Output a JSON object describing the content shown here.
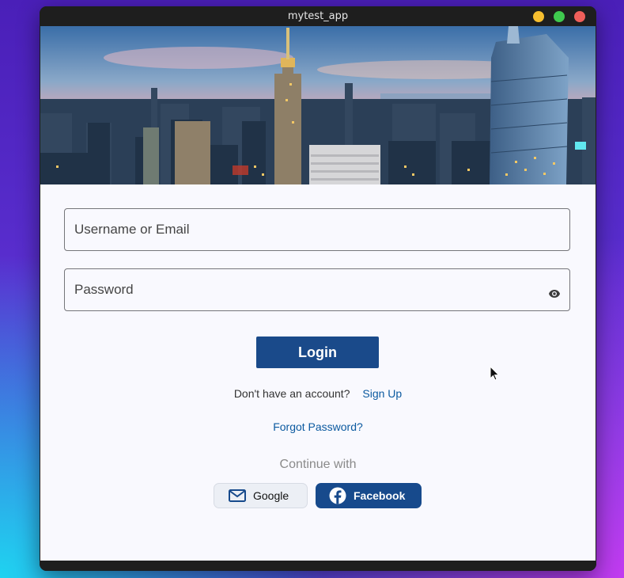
{
  "window": {
    "title": "mytest_app"
  },
  "form": {
    "username_placeholder": "Username or Email",
    "password_placeholder": "Password",
    "login_label": "Login",
    "no_account_text": "Don't have an account?",
    "signup_label": "Sign Up",
    "forgot_label": "Forgot Password?",
    "continue_text": "Continue with"
  },
  "social": {
    "google_label": "Google",
    "facebook_label": "Facebook"
  },
  "icons": {
    "password_toggle": "eye-icon",
    "google": "mail-icon",
    "facebook": "facebook-icon"
  },
  "colors": {
    "primary": "#1a4a8a",
    "link": "#0c5aa0",
    "facebook": "#174a8c"
  }
}
